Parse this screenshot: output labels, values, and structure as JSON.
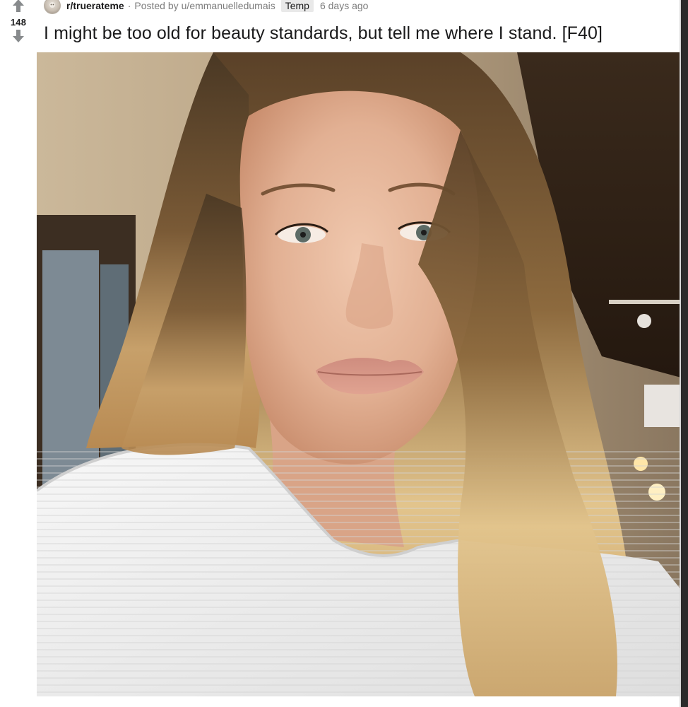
{
  "vote": {
    "score": "148",
    "upvote_icon": "arrow-up-icon",
    "downvote_icon": "arrow-down-icon"
  },
  "post": {
    "subreddit": "r/truerateme",
    "separator": "·",
    "posted_by_prefix": "Posted by",
    "author": "u/emmanuelledumais",
    "flair": "Temp",
    "time_ago": "6 days ago",
    "title": "I might be too old for beauty standards, but tell me where I stand. [F40]"
  },
  "colors": {
    "title_text": "#1a1a1b",
    "meta_text": "#7c7c7c",
    "vote_arrow": "#878a8c",
    "flair_bg": "#e9e9e9"
  }
}
